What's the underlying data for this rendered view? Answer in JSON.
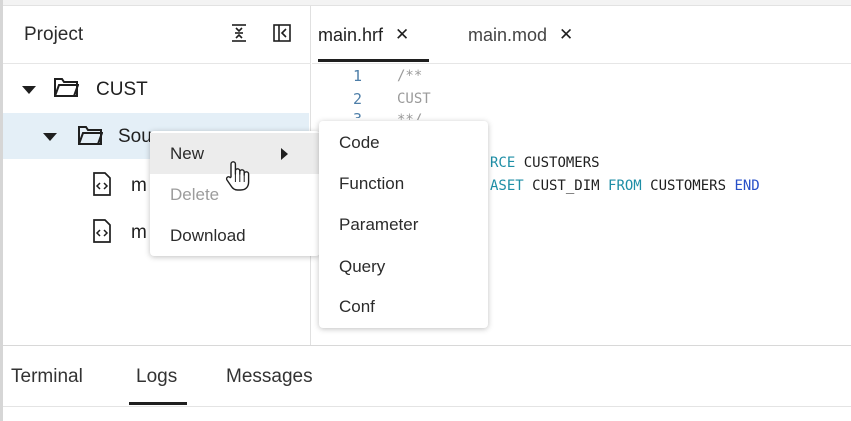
{
  "project_panel": {
    "title": "Project",
    "header_icons": [
      "collapse-all-icon",
      "toggle-sidebar-icon"
    ],
    "tree": [
      {
        "label": "CUST",
        "type": "folder",
        "expanded": true
      },
      {
        "label": "Sou",
        "type": "folder",
        "expanded": true,
        "selected": true
      },
      {
        "label": "m",
        "type": "file"
      },
      {
        "label": "m",
        "type": "file"
      }
    ]
  },
  "editor": {
    "tabs": [
      {
        "label": "main.hrf",
        "close": "✕",
        "active": true
      },
      {
        "label": "main.mod",
        "close": "✕",
        "active": false
      }
    ],
    "line_numbers": [
      "1",
      "2",
      "3"
    ],
    "lines": {
      "l1": "/**",
      "l2": "CUST",
      "l3": "**/",
      "l4_kw": "RCE",
      "l4_id": " CUSTOMERS",
      "l5_kw": "ASET",
      "l5_id1": " CUST_DIM ",
      "l5_kw2": "FROM",
      "l5_id2": " CUSTOMERS ",
      "l5_kw3": "END"
    }
  },
  "context_menu": {
    "items": [
      {
        "label": "New",
        "has_submenu": true,
        "hover": true
      },
      {
        "label": "Delete",
        "disabled": true
      },
      {
        "label": "Download"
      }
    ]
  },
  "submenu": {
    "items": [
      "Code",
      "Function",
      "Parameter",
      "Query",
      "Conf"
    ]
  },
  "bottom_panel": {
    "tabs": [
      {
        "label": "Terminal"
      },
      {
        "label": "Logs",
        "active": true
      },
      {
        "label": "Messages"
      }
    ]
  },
  "colors": {
    "selected_row": "#e4eff7",
    "keyword": "#1e8ea6",
    "keyword_alt": "#2850c8",
    "comment": "#9a9a9a",
    "line_number": "#4d7ea8"
  }
}
